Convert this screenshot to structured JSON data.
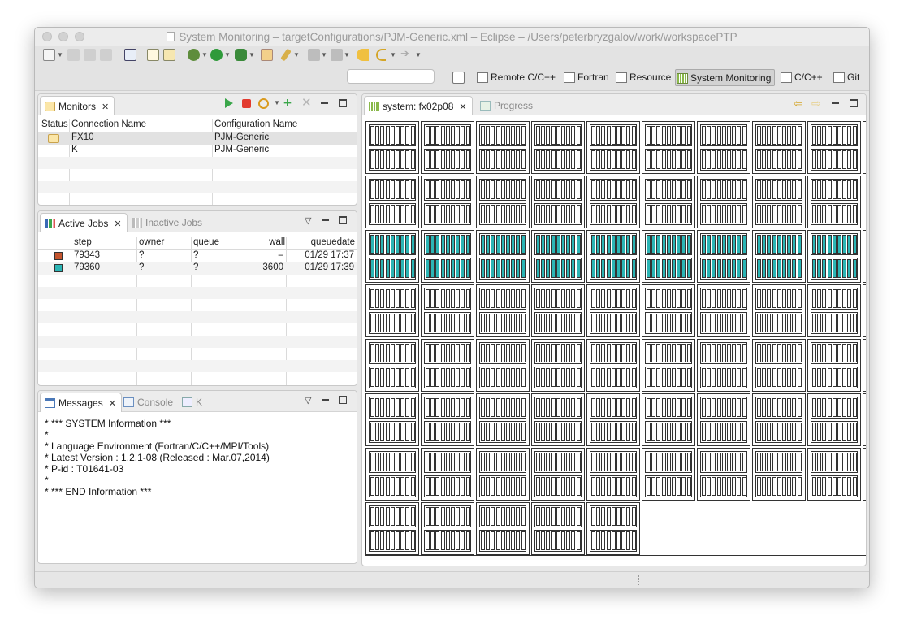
{
  "window": {
    "title": "System Monitoring – targetConfigurations/PJM-Generic.xml – Eclipse – /Users/peterbryzgalov/work/workspacePTP"
  },
  "perspectives": [
    {
      "label": "Remote C/C++",
      "icon": "remote-cpp-perspective-icon",
      "active": false
    },
    {
      "label": "Fortran",
      "icon": "fortran-perspective-icon",
      "active": false
    },
    {
      "label": "Resource",
      "icon": "resource-perspective-icon",
      "active": false
    },
    {
      "label": "System Monitoring",
      "icon": "system-monitoring-perspective-icon",
      "active": true
    },
    {
      "label": "C/C++",
      "icon": "cpp-perspective-icon",
      "active": false
    },
    {
      "label": "Git",
      "icon": "git-perspective-icon",
      "active": false
    }
  ],
  "monitors": {
    "tab_label": "Monitors",
    "columns": [
      "Status",
      "Connection Name",
      "Configuration Name"
    ],
    "rows": [
      {
        "connection": "FX10",
        "configuration": "PJM-Generic",
        "status_icon": "connected-icon"
      },
      {
        "connection": "K",
        "configuration": "PJM-Generic",
        "status_icon": ""
      }
    ]
  },
  "jobs": {
    "active_tab": "Active Jobs",
    "inactive_tab": "Inactive Jobs",
    "columns": [
      "step",
      "owner",
      "queue",
      "wall",
      "queuedate"
    ],
    "rows": [
      {
        "step": "79343",
        "owner": "?",
        "queue": "?",
        "wall": "–",
        "queuedate": "01/29 17:37",
        "color": "#c4552e"
      },
      {
        "step": "79360",
        "owner": "?",
        "queue": "?",
        "wall": "3600",
        "queuedate": "01/29 17:39",
        "color": "#2bb5b5"
      }
    ]
  },
  "messages": {
    "tab_label": "Messages",
    "console_tab": "Console",
    "k_tab": "K",
    "lines": [
      "* *** SYSTEM Information ***",
      "*",
      "* Language Environment (Fortran/C/C++/MPI/Tools)",
      "* Latest Version : 1.2.1-08 (Released : Mar.07,2014)",
      "* P-id : T01641-03",
      "*",
      "* *** END Information ***"
    ]
  },
  "system_view": {
    "tab_label": "system: fx02p08",
    "progress_tab": "Progress",
    "busy_color": "#2bb5b5",
    "rows_of_cabinets": 8,
    "busy_row": 2,
    "last_row_cabinets": 5
  }
}
